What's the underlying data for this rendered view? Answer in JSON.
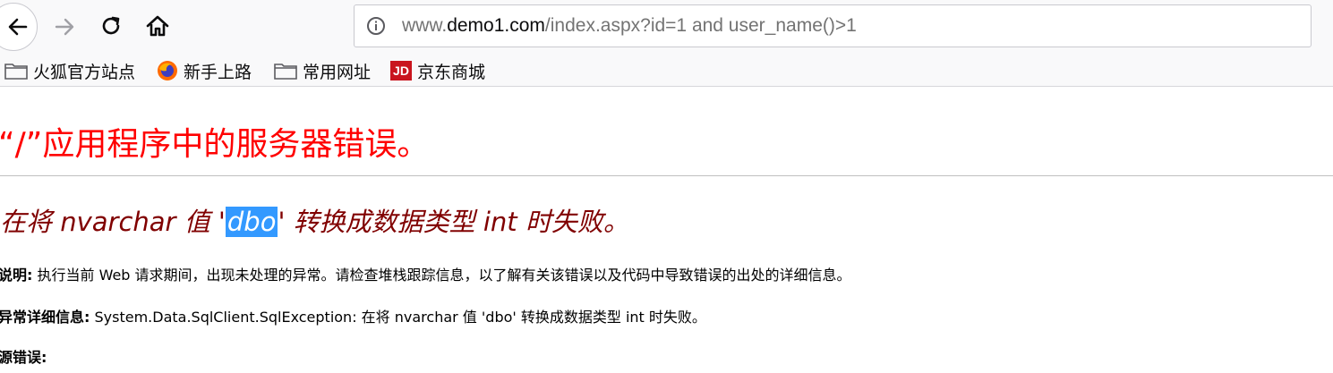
{
  "nav": {
    "back": "back-arrow",
    "forward": "forward-arrow",
    "reload": "reload",
    "home": "home"
  },
  "urlbar": {
    "prefix": "www.",
    "domain": "demo1.com",
    "path": "/index.aspx?id=1 and user_name()>1"
  },
  "bookmarks": [
    {
      "icon": "folder-icon",
      "label": "火狐官方站点"
    },
    {
      "icon": "firefox-icon",
      "label": "新手上路"
    },
    {
      "icon": "folder-icon",
      "label": "常用网址"
    },
    {
      "icon": "jd-icon",
      "icon_text": "JD",
      "label": "京东商城"
    }
  ],
  "page": {
    "title": "“/”应用程序中的服务器错误。",
    "error_pre": "在将 nvarchar 值 '",
    "error_sel": "dbo",
    "error_post": "' 转换成数据类型 int 时失败。",
    "desc_label": "说明:",
    "desc_text": " 执行当前 Web 请求期间，出现未处理的异常。请检查堆栈跟踪信息，以了解有关该错误以及代码中导致错误的出处的详细信息。",
    "detail_label": "异常详细信息:",
    "detail_text": " System.Data.SqlClient.SqlException: 在将 nvarchar 值 'dbo' 转换成数据类型 int 时失败。",
    "source_label": "源错误:"
  },
  "colors": {
    "title": "#ff0000",
    "error": "#800000",
    "selection": "#3399ff"
  }
}
